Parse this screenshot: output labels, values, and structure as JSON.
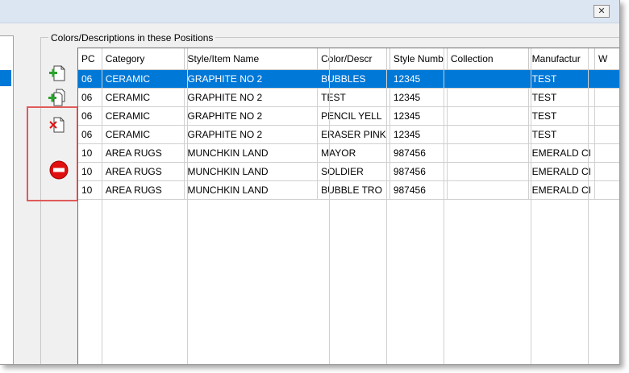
{
  "titlebar": {
    "close_label": "✕"
  },
  "group": {
    "title": "Colors/Descriptions in these Positions"
  },
  "toolbar": [
    {
      "name": "add-item-icon"
    },
    {
      "name": "add-multiple-items-icon"
    },
    {
      "name": "remove-item-icon"
    },
    {
      "name": "delete-all-icon"
    }
  ],
  "table": {
    "columns": [
      "PC",
      "Category",
      "Style/Item Name",
      "Color/Descr",
      "Style Numb",
      "Collection",
      "Manufactur",
      "W"
    ],
    "rows": [
      [
        "06",
        "CERAMIC",
        "GRAPHITE NO 2",
        "BUBBLES",
        "12345",
        "",
        "TEST",
        ""
      ],
      [
        "06",
        "CERAMIC",
        "GRAPHITE NO 2",
        "TEST",
        "12345",
        "",
        "TEST",
        ""
      ],
      [
        "06",
        "CERAMIC",
        "GRAPHITE NO 2",
        "PENCIL YELL",
        "12345",
        "",
        "TEST",
        ""
      ],
      [
        "06",
        "CERAMIC",
        "GRAPHITE NO 2",
        "ERASER PINK",
        "12345",
        "",
        "TEST",
        ""
      ],
      [
        "10",
        "AREA RUGS",
        "MUNCHKIN LAND",
        "MAYOR",
        "987456",
        "",
        "EMERALD CI",
        ""
      ],
      [
        "10",
        "AREA RUGS",
        "MUNCHKIN LAND",
        "SOLDIER",
        "987456",
        "",
        "EMERALD CI",
        ""
      ],
      [
        "10",
        "AREA RUGS",
        "MUNCHKIN LAND",
        "BUBBLE TRO",
        "987456",
        "",
        "EMERALD CI",
        ""
      ]
    ],
    "selected_row": 0
  },
  "colors": {
    "selection": "#0078d7",
    "highlight_box": "#e05a5a",
    "add_green": "#2ea12e",
    "delete_red": "#e01010"
  }
}
